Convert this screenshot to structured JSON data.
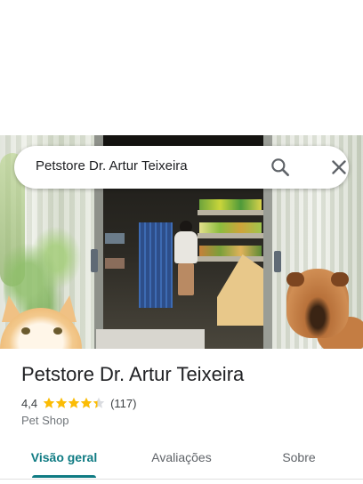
{
  "search": {
    "query": "Petstore Dr. Artur Teixeira",
    "search_icon": "search-icon",
    "close_icon": "close-icon"
  },
  "place": {
    "title": "Petstore Dr. Artur Teixeira",
    "rating": "4,4",
    "rating_value": 4.4,
    "rating_max": 5,
    "review_count": "(117)",
    "category": "Pet Shop"
  },
  "tabs": [
    {
      "label": "Visão geral",
      "active": true
    },
    {
      "label": "Avaliações",
      "active": false
    },
    {
      "label": "Sobre",
      "active": false
    }
  ],
  "colors": {
    "accent": "#0f7b83",
    "star": "#fbbc04",
    "star_empty": "#dadce0"
  }
}
